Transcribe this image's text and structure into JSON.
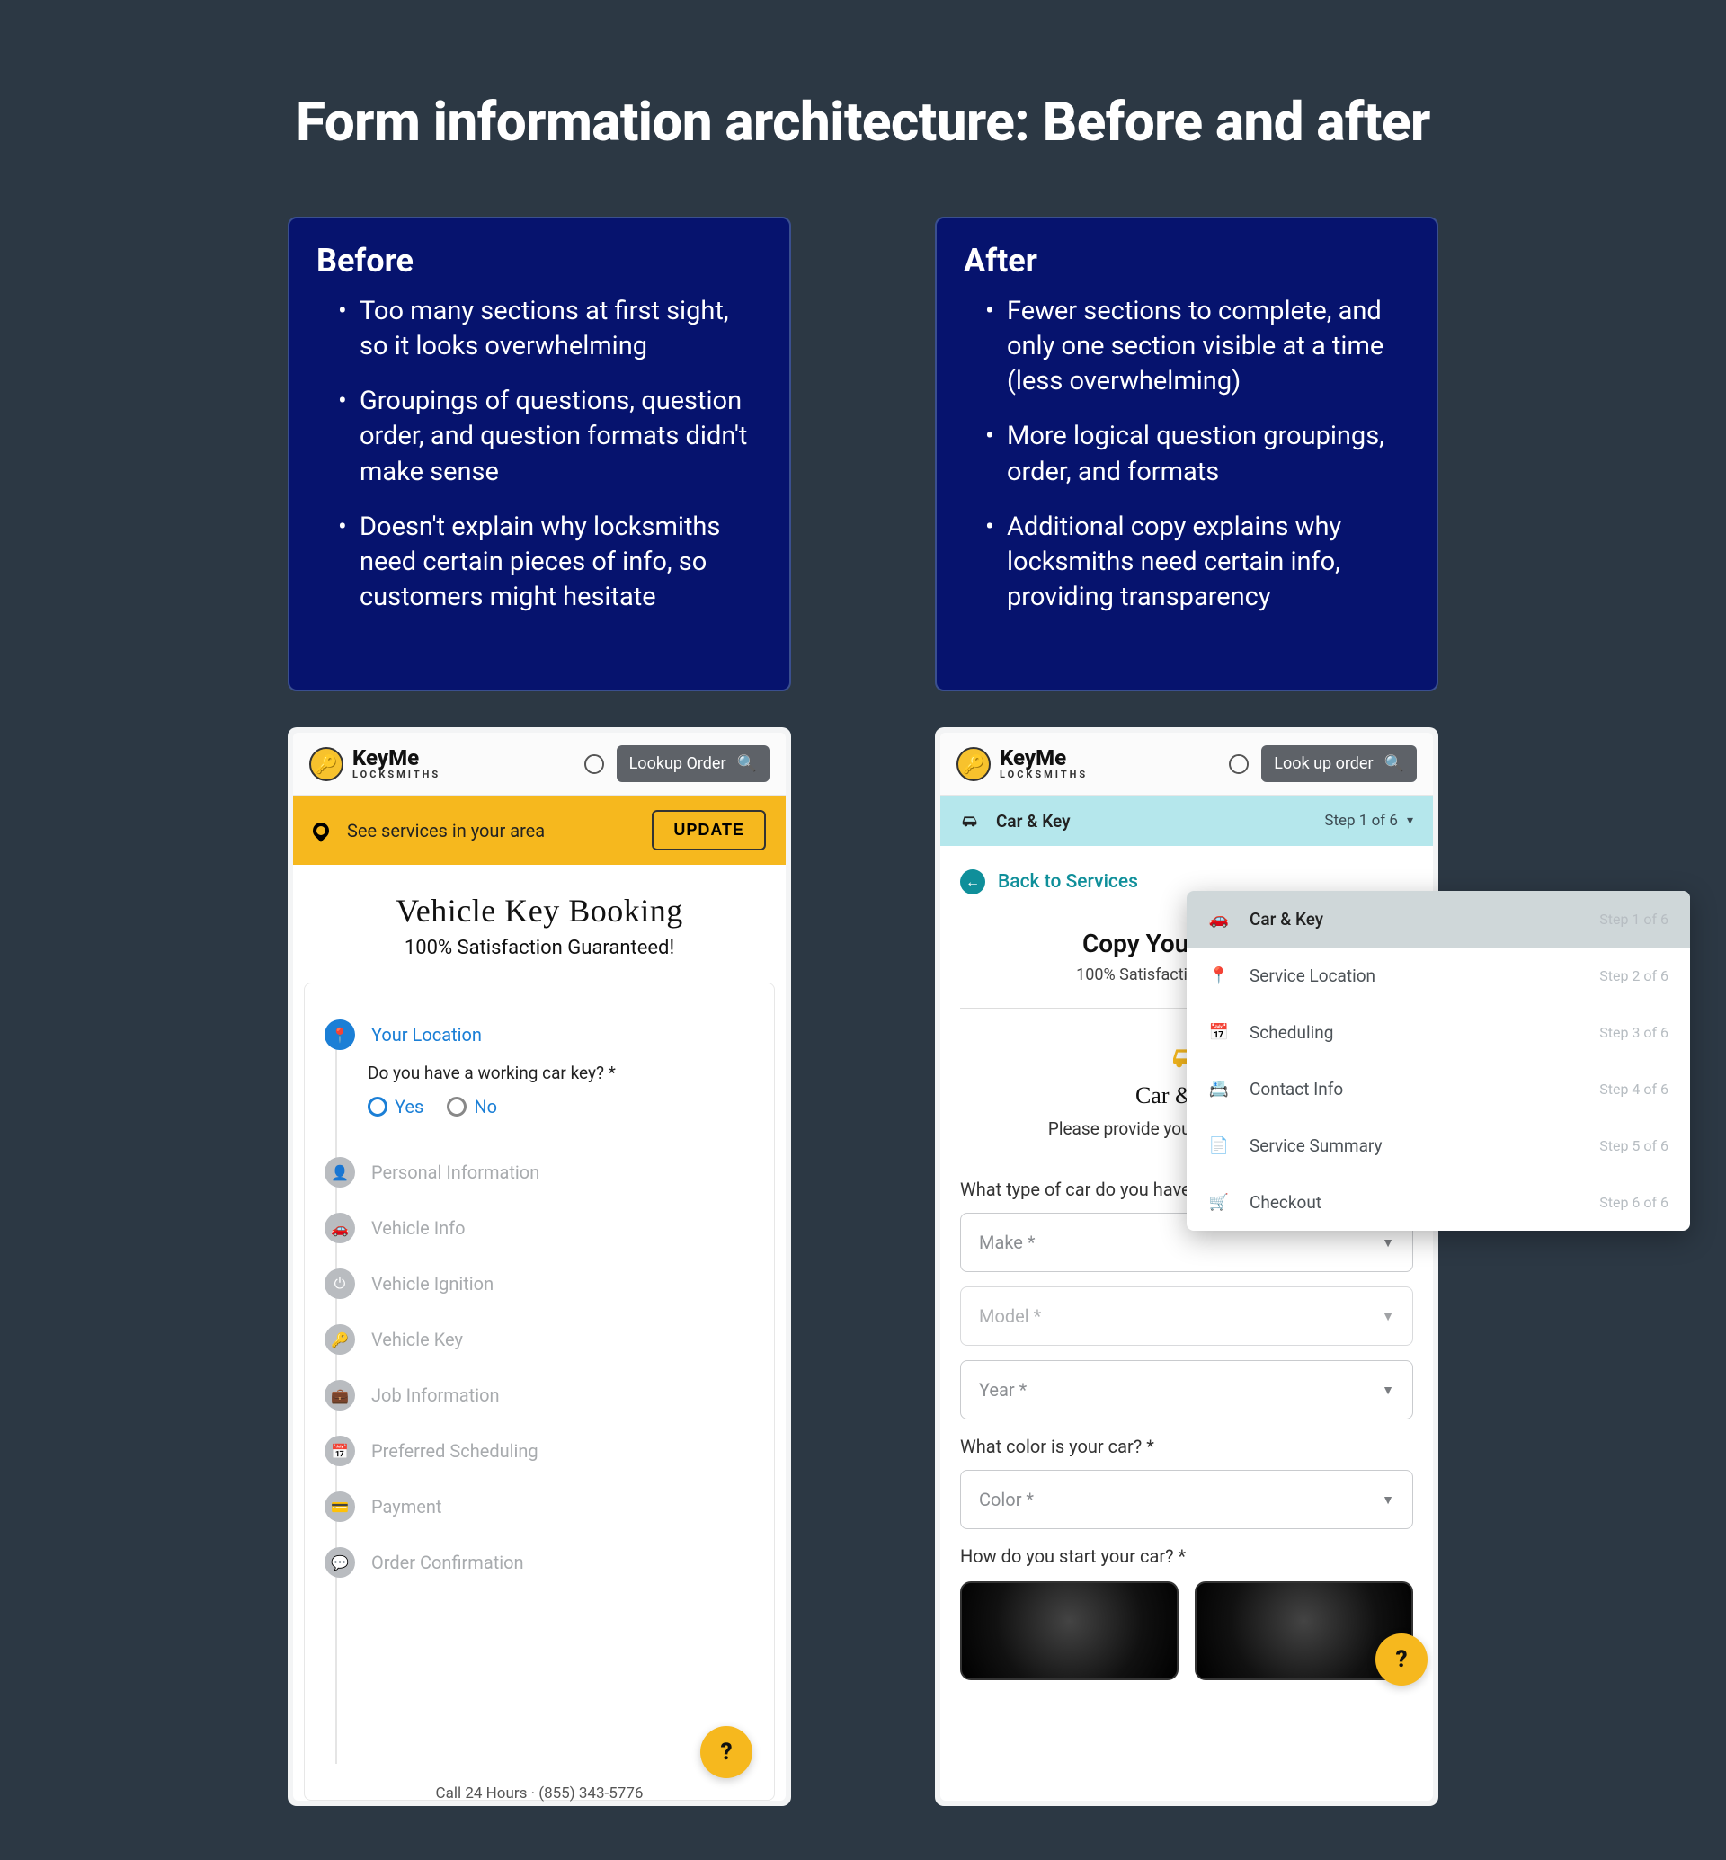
{
  "page_title": "Form information architecture: Before and after",
  "before": {
    "heading": "Before",
    "bullets": [
      "Too many sections at first sight, so it looks overwhelming",
      "Groupings of questions, question order, and question formats didn't make sense",
      "Doesn't explain why locksmiths need certain pieces of info, so customers might hesitate"
    ],
    "app": {
      "brand": "KeyMe",
      "brand_sub": "LOCKSMITHS",
      "lookup_label": "Lookup Order",
      "yellow_bar_text": "See services in your area",
      "update_button": "UPDATE",
      "title": "Vehicle Key Booking",
      "subtitle": "100% Satisfaction Guaranteed!",
      "active_step": "Your Location",
      "question": "Do you have a working car key? *",
      "yes": "Yes",
      "no": "No",
      "steps": [
        "Personal Information",
        "Vehicle Info",
        "Vehicle Ignition",
        "Vehicle Key",
        "Job Information",
        "Preferred Scheduling",
        "Payment",
        "Order Confirmation"
      ],
      "footer": "Call 24 Hours · (855) 343-5776"
    }
  },
  "after": {
    "heading": "After",
    "bullets": [
      "Fewer sections to complete, and only one section visible at a time (less overwhelming)",
      "More logical question groupings, order, and formats",
      "Additional copy explains why locksmiths need certain info, providing transparency"
    ],
    "app": {
      "brand": "KeyMe",
      "brand_sub": "LOCKSMITHS",
      "lookup_label": "Look up order",
      "step_bar_label": "Car & Key",
      "step_bar_meta": "Step 1 of 6",
      "back_link": "Back to Services",
      "title": "Copy Your Car Key",
      "subtitle": "100% Satisfaction Guaranteed!",
      "section_title": "Car & Key",
      "section_desc": "Please provide your car and key info.",
      "q1": "What type of car do you have? *",
      "make": "Make *",
      "model": "Model *",
      "year": "Year *",
      "q2": "What color is your car? *",
      "color": "Color *",
      "q3": "How do you start your car? *"
    },
    "steps_popover": [
      {
        "label": "Car & Key",
        "meta": "Step 1 of 6"
      },
      {
        "label": "Service Location",
        "meta": "Step 2 of 6"
      },
      {
        "label": "Scheduling",
        "meta": "Step 3 of 6"
      },
      {
        "label": "Contact Info",
        "meta": "Step 4 of 6"
      },
      {
        "label": "Service Summary",
        "meta": "Step 5 of 6"
      },
      {
        "label": "Checkout",
        "meta": "Step 6 of 6"
      }
    ]
  }
}
